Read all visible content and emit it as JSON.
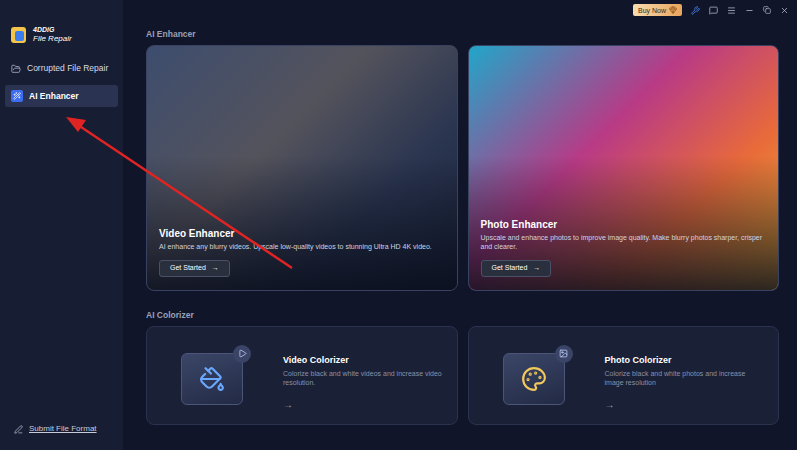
{
  "app": {
    "name": "4DDiG",
    "subtitle": "File Repair"
  },
  "topbar": {
    "buy_button": "Buy Now"
  },
  "sidebar": {
    "items": [
      {
        "label": "Corrupted File Repair",
        "selected": false
      },
      {
        "label": "AI Enhancer",
        "selected": true
      }
    ],
    "footer_link": "Submit File Format"
  },
  "sections": [
    {
      "title": "AI Enhancer",
      "cards": [
        {
          "kind": "photo",
          "title": "Video Enhancer",
          "description": "AI enhance any blurry videos. Upscale low-quality videos to stunning Ultra HD 4K video.",
          "button": "Get Started",
          "arrow": "→"
        },
        {
          "kind": "photo",
          "title": "Photo Enhancer",
          "description": "Upscale and enhance photos to improve image quality. Make blurry photos sharper, crisper and clearer.",
          "button": "Get Started",
          "arrow": "→"
        }
      ]
    },
    {
      "title": "AI Colorizer",
      "cards": [
        {
          "kind": "tile",
          "title": "Video Colorizer",
          "description": "Colorize black and white videos and increase video resolution.",
          "arrow": "→"
        },
        {
          "kind": "tile",
          "title": "Photo Colorizer",
          "description": "Colorize black and white photos and increase image resolution",
          "arrow": "→"
        }
      ]
    }
  ]
}
